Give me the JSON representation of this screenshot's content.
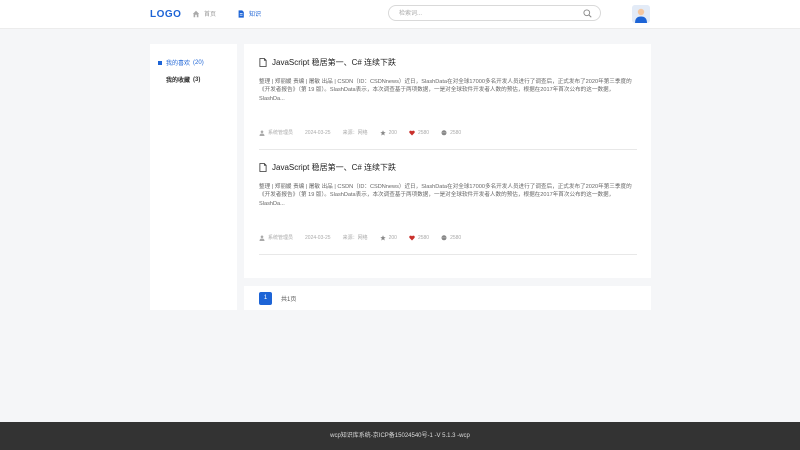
{
  "header": {
    "logo": "LOGO",
    "nav": [
      {
        "label": "首页",
        "icon": "home-icon"
      },
      {
        "label": "知识",
        "icon": "document-icon"
      }
    ],
    "search_placeholder": "检索词...",
    "avatar_icon": "user-avatar-icon"
  },
  "sidebar": {
    "items": [
      {
        "label": "我的喜欢",
        "count": "(20)",
        "active": true
      },
      {
        "label": "我的收藏",
        "count": "(3)",
        "active": false
      }
    ]
  },
  "articles": [
    {
      "title": "JavaScript 稳居第一、C# 连续下跌",
      "body": "整理 | 郑丽媛 责编 | 屠敏 出品 | CSDN（ID：CSDNnews）近日，SlashData在对全球17000多名开发人员进行了调查后，正式发布了2020年第三季度的《开发者报告》（第 19 版）。SlashData表示，本次调查基于两项数据，一是对全球软件开发者人数的预估，根据在2017年首次公布的这一数据，SlashDa...",
      "author": "系统管理员",
      "date": "2024-03-25",
      "source": "来源：网络",
      "stars": "200",
      "likes": "2580",
      "comments": "2580"
    },
    {
      "title": "JavaScript 稳居第一、C# 连续下跌",
      "body": "整理 | 郑丽媛 责编 | 屠敏 出品 | CSDN（ID：CSDNnews）近日，SlashData在对全球17000多名开发人员进行了调查后，正式发布了2020年第三季度的《开发者报告》（第 19 版）。SlashData表示，本次调查基于两项数据，一是对全球软件开发者人数的预估，根据在2017年首次公布的这一数据，SlashDa...",
      "author": "系统管理员",
      "date": "2024-03-25",
      "source": "来源：网络",
      "stars": "200",
      "likes": "2580",
      "comments": "2580"
    }
  ],
  "pagination": {
    "current": "1",
    "total": "共1页"
  },
  "footer": {
    "text": "wcp知识库系统-京ICP备15024540号-1 -V 5.1.3 -wcp"
  },
  "colors": {
    "accent": "#1d64d6",
    "like": "#c9302c",
    "footer_bg": "#333333"
  }
}
